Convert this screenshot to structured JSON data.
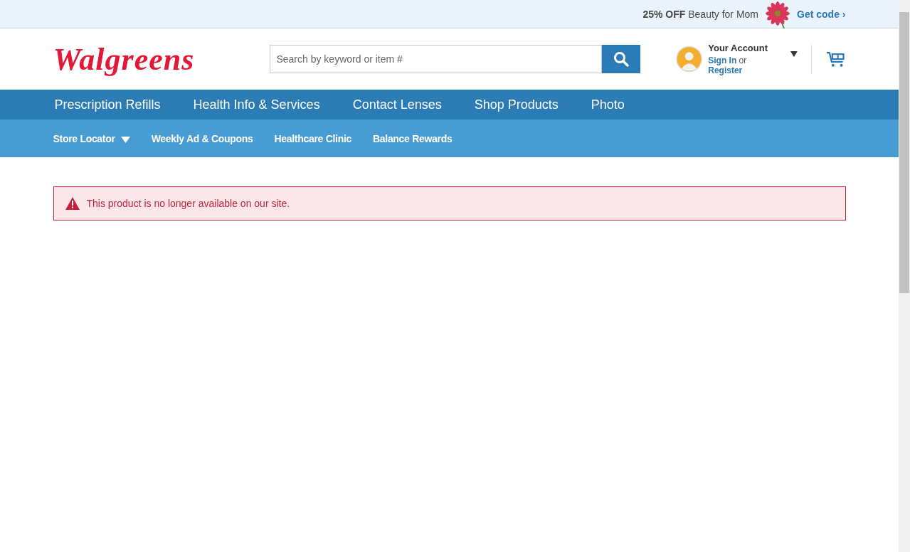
{
  "promo": {
    "text": "**25% OFF** Beauty for Mom",
    "link": "Get code ›"
  },
  "header": {
    "logo": "Walgreens",
    "search": {
      "placeholder": "Search by keyword or item #"
    },
    "account": {
      "title": "Your Account",
      "sign_in": "Sign In",
      "or": "or",
      "register": "Register"
    }
  },
  "main_nav": [
    "Prescription Refills",
    "Health Info & Services",
    "Contact Lenses",
    "Shop Products",
    "Photo"
  ],
  "sub_nav": [
    {
      "label": "Store Locator",
      "dropdown": true
    },
    {
      "label": "Weekly Ad & Coupons",
      "dropdown": false
    },
    {
      "label": "Healthcare Clinic",
      "dropdown": false
    },
    {
      "label": "Balance Rewards",
      "dropdown": false
    }
  ],
  "alert": {
    "kind": "error",
    "message": "This product is no longer available on our site."
  }
}
